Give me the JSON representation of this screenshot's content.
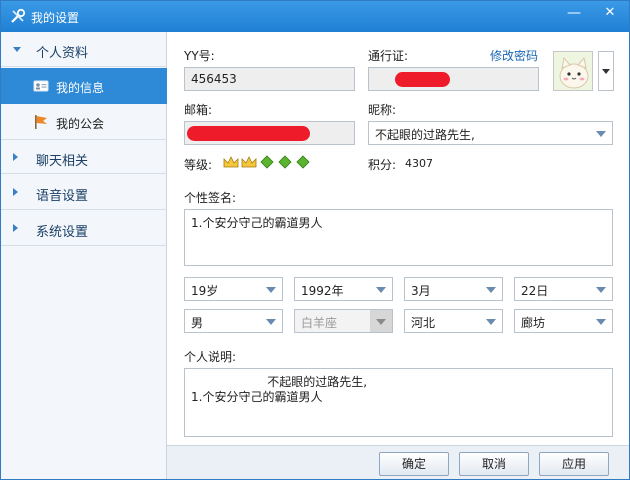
{
  "window": {
    "title": "我的设置",
    "icon": "settings-wrench-icon",
    "minimize": "—",
    "close": "✕"
  },
  "sidebar": {
    "groups": [
      {
        "label": "个人资料",
        "expanded": true
      },
      {
        "label": "聊天相关",
        "expanded": false
      },
      {
        "label": "语音设置",
        "expanded": false
      },
      {
        "label": "系统设置",
        "expanded": false
      }
    ],
    "items": [
      {
        "label": "我的信息",
        "active": true,
        "icon": "id-card-icon"
      },
      {
        "label": "我的公会",
        "active": false,
        "icon": "flag-icon"
      }
    ]
  },
  "profile": {
    "yy_label": "YY号:",
    "yy_value": "456453",
    "passport_label": "通行证:",
    "change_password": "修改密码",
    "email_label": "邮箱:",
    "nickname_label": "昵称:",
    "nickname_value": "不起眼的过路先生,",
    "level_label": "等级:",
    "points_label": "积分:",
    "points_value": "4307",
    "signature_label": "个性签名:",
    "signature_value": "1.个安分守己的霸道男人",
    "age": "19岁",
    "birth_year": "1992年",
    "birth_month": "3月",
    "birth_day": "22日",
    "gender": "男",
    "zodiac": "白羊座",
    "province": "河北",
    "city": "廊坊",
    "description_label": "个人说明:",
    "description_value": "                    不起眼的过路先生,\n1.个安分守己的霸道男人"
  },
  "footer": {
    "ok": "确定",
    "cancel": "取消",
    "apply": "应用"
  },
  "colors": {
    "titlebar": "#1f7fd3",
    "active_item": "#2e8ad6",
    "redaction": "#ee1c2a",
    "link": "#1a66b3"
  }
}
